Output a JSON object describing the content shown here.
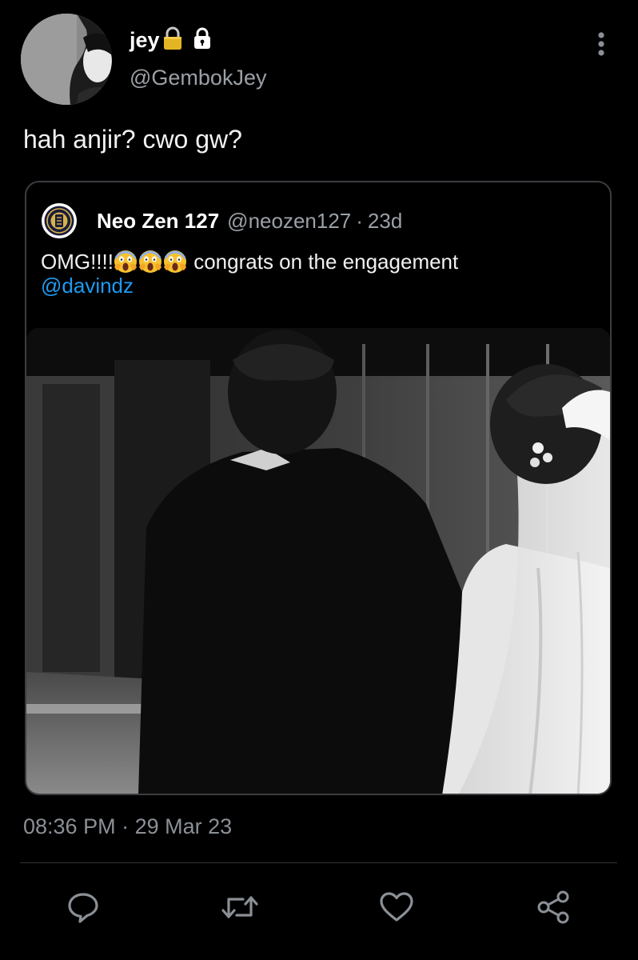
{
  "tweet": {
    "author": {
      "display_name": "jey",
      "name_emoji": "🔒",
      "handle": "@GembokJey",
      "protected_icon": "lock-icon",
      "avatar_icon": "avatar-photo"
    },
    "text": "hah anjir? cwo gw?",
    "timestamp": "08:36 PM",
    "date_separator": "·",
    "date": "29 Mar 23",
    "more_icon": "more-vertical-icon"
  },
  "quote": {
    "author": {
      "display_name": "Neo Zen 127",
      "handle": "@neozen127",
      "separator": "·",
      "time": "23d",
      "avatar_icon": "neo-zen-logo"
    },
    "text_prefix": "OMG!!!!",
    "emoji": "😱",
    "emoji_count": 3,
    "text_suffix": " congrats on the engagement",
    "mention": "@davindz",
    "media_icon": "photo-couple-black-white"
  },
  "actions": [
    {
      "name": "reply",
      "icon": "reply-bubble-icon"
    },
    {
      "name": "retweet",
      "icon": "retweet-icon"
    },
    {
      "name": "like",
      "icon": "heart-icon"
    },
    {
      "name": "share",
      "icon": "share-icon"
    }
  ],
  "colors": {
    "background": "#000000",
    "text": "#e7e9ea",
    "secondary": "#9ba0a6",
    "link": "#1d9bf0",
    "border": "#3a3d41",
    "icon": "#8b9096"
  }
}
